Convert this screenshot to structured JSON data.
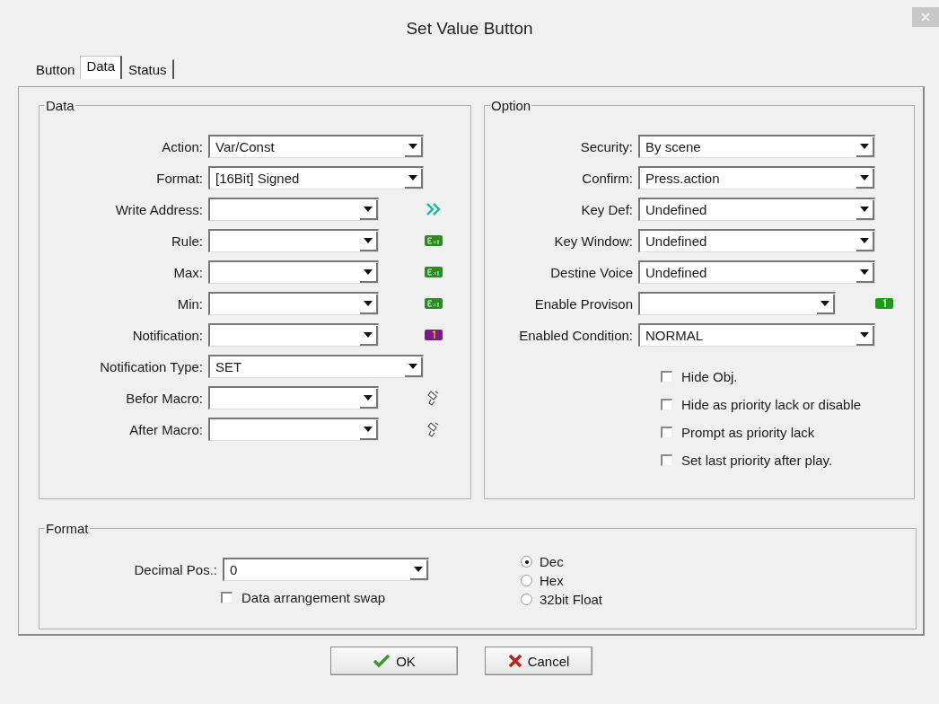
{
  "window": {
    "title": "Set Value Button"
  },
  "tabs": [
    {
      "label": "Button",
      "selected": false
    },
    {
      "label": "Data",
      "selected": true
    },
    {
      "label": "Status",
      "selected": false
    }
  ],
  "data_group": {
    "title": "Data",
    "rows": [
      {
        "kind": "wide",
        "label": "Action:",
        "value": "Var/Const"
      },
      {
        "kind": "wide",
        "label": "Format:",
        "value": "[16Bit] Signed"
      },
      {
        "kind": "address",
        "label": "Write Address:"
      },
      {
        "kind": "exp",
        "label": "Rule:"
      },
      {
        "kind": "exp",
        "label": "Max:"
      },
      {
        "kind": "exp",
        "label": "Min:"
      },
      {
        "kind": "notify",
        "label": "Notification:"
      },
      {
        "kind": "wide",
        "label": "Notification Type:",
        "value": "SET"
      },
      {
        "kind": "macro",
        "label": "Befor Macro:"
      },
      {
        "kind": "macro",
        "label": "After Macro:"
      }
    ]
  },
  "option_group": {
    "title": "Option",
    "rows": [
      {
        "kind": "wide",
        "label": "Security:",
        "value": "By scene"
      },
      {
        "kind": "wide",
        "label": "Confirm:",
        "value": "Press.action"
      },
      {
        "kind": "wide",
        "label": "Key Def:",
        "value": "Undefined"
      },
      {
        "kind": "wide",
        "label": "Key Window:",
        "value": "Undefined"
      },
      {
        "kind": "wide",
        "label": "Destine Voice",
        "value": "Undefined"
      },
      {
        "kind": "provision",
        "label": "Enable Provison"
      },
      {
        "kind": "wide",
        "label": "Enabled Condition:",
        "value": "NORMAL"
      }
    ],
    "checkboxes": [
      {
        "label": "Hide Obj.",
        "checked": false
      },
      {
        "label": "Hide as priority lack or disable",
        "checked": false
      },
      {
        "label": "Prompt as priority lack",
        "checked": false
      },
      {
        "label": "Set last priority after play.",
        "checked": false
      }
    ]
  },
  "format_group": {
    "title": "Format",
    "decimal_label": "Decimal Pos.:",
    "decimal_value": "0",
    "swap": {
      "label": "Data arrangement swap",
      "checked": false
    },
    "radios": [
      {
        "label": "Dec",
        "selected": true
      },
      {
        "label": "Hex",
        "selected": false
      },
      {
        "label": "32bit Float",
        "selected": false
      }
    ]
  },
  "buttons": [
    {
      "kind": "ok",
      "label": "OK"
    },
    {
      "kind": "cancel",
      "label": "Cancel"
    }
  ]
}
